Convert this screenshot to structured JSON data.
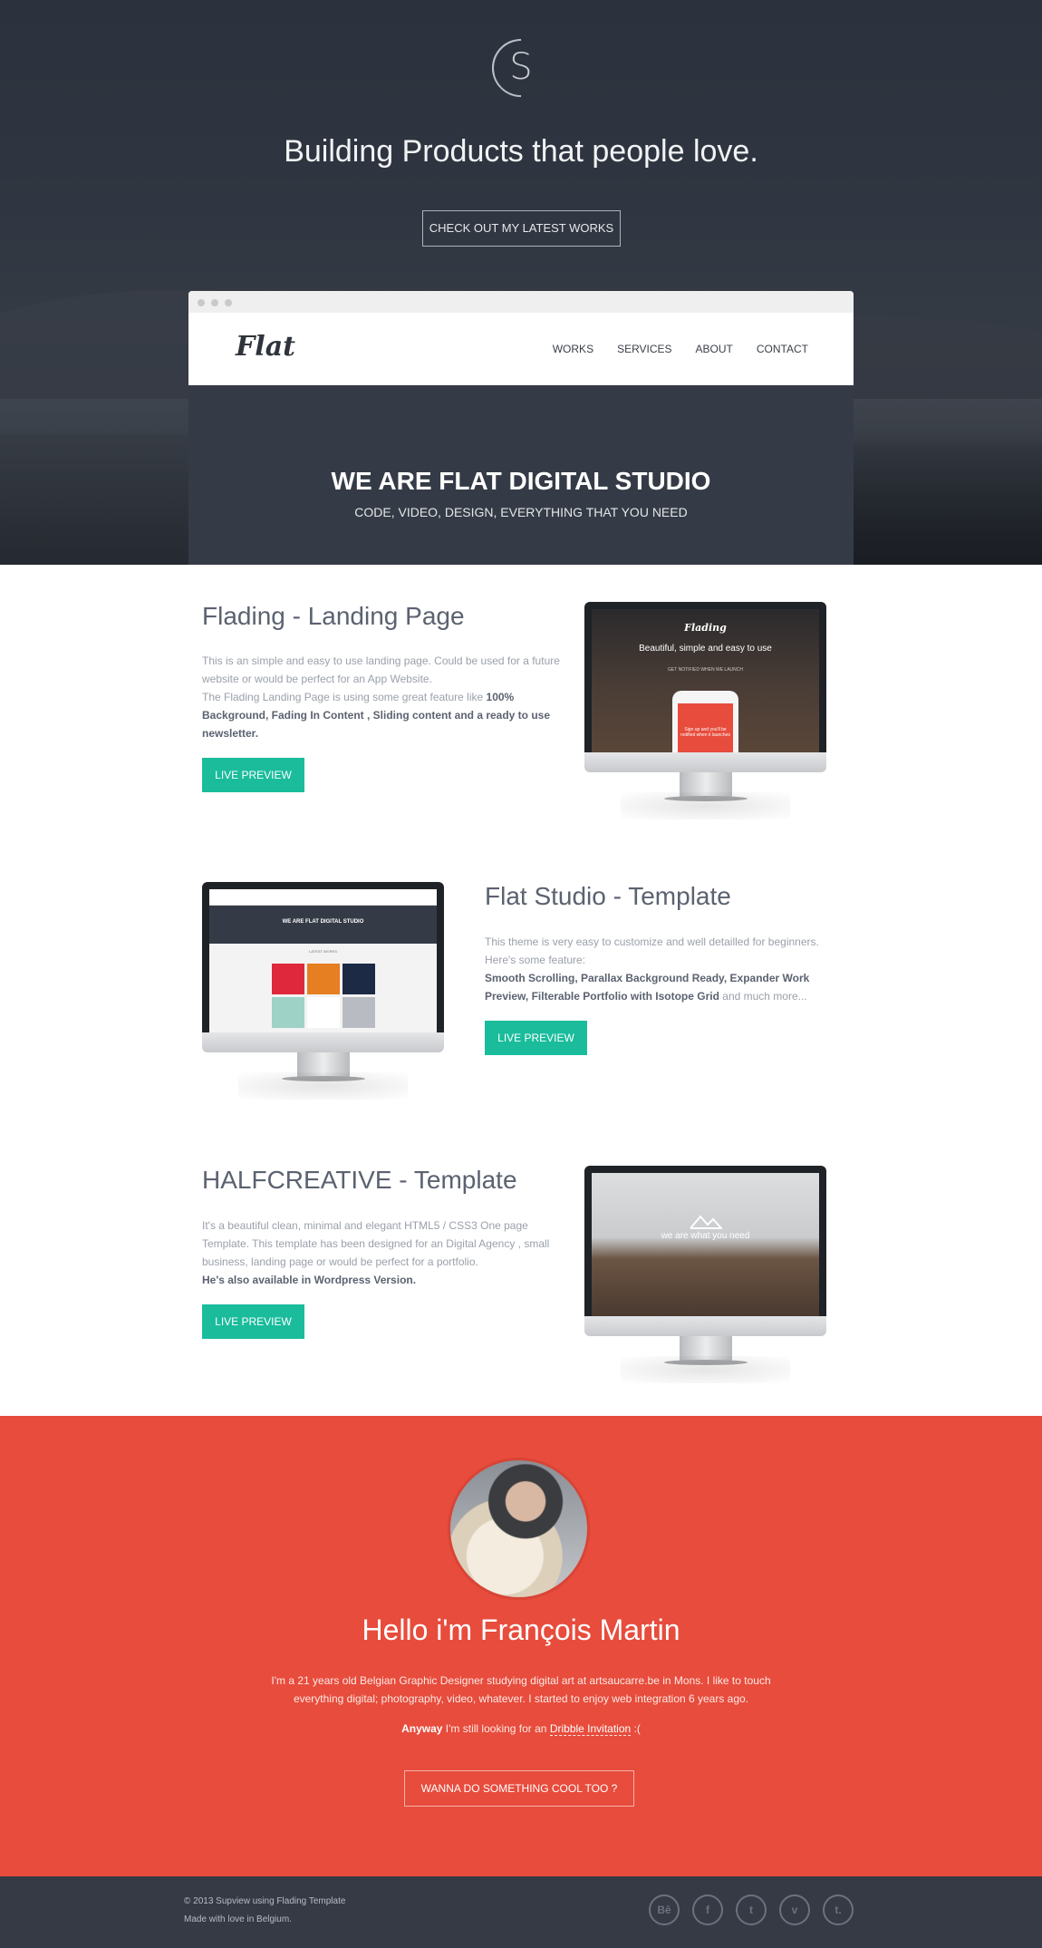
{
  "hero": {
    "logo_letter": "S",
    "title": "Building Products that people love.",
    "cta_label": "CHECK OUT MY LATEST WORKS"
  },
  "browser_mock": {
    "brand": "Flat",
    "nav": [
      "WORKS",
      "SERVICES",
      "ABOUT",
      "CONTACT"
    ],
    "banner_title": "WE ARE FLAT DIGITAL STUDIO",
    "banner_subtitle": "CODE, VIDEO, DESIGN, EVERYTHING THAT YOU NEED"
  },
  "works": [
    {
      "title": "Flading - Landing Page",
      "desc_1": "This is an simple and easy to use landing page. Could be used for a future website or would be perfect for an App Website.",
      "desc_2_pre": "The Flading Landing Page is using some great feature like ",
      "desc_2_bold": "100% Background, Fading In Content , Sliding content and a ready to use newsletter.",
      "button": "LIVE PREVIEW",
      "screen_logo": "Flading",
      "screen_headline": "Beautiful, simple and easy to use",
      "screen_small": "GET NOTIFIED WHEN WE LAUNCH",
      "screen_phone": "Sign up and you'll be notified when it launches"
    },
    {
      "title": "Flat Studio - Template",
      "desc_1": "This theme is very easy to customize and well detailled for beginners.",
      "desc_2": "Here's some feature:",
      "desc_3_bold": "Smooth Scrolling, Parallax Background Ready, Expander Work Preview, Filterable Portfolio with Isotope Grid",
      "desc_3_post": " and much more...",
      "button": "LIVE PREVIEW",
      "screen_headline": "WE ARE FLAT DIGITAL STUDIO",
      "screen_section": "LATEST WORKS"
    },
    {
      "title": "HALFCREATIVE - Template",
      "desc_1": "It's a beautiful clean, minimal and elegant HTML5 / CSS3 One page Template. This template has been designed for an Digital Agency , small business, landing page or would be perfect for a portfolio.",
      "desc_2_bold": "He's also available in Wordpress Version.",
      "button": "LIVE PREVIEW",
      "screen_headline": "we are what you need"
    }
  ],
  "about": {
    "title": "Hello i'm François Martin",
    "text": "I'm a 21 years old Belgian Graphic Designer studying digital art at artsaucarre.be in Mons. I like to touch everything digital; photography, video, whatever. I started to enjoy web integration 6 years ago.",
    "text2_bold": "Anyway",
    "text2_mid": " I'm still looking for an ",
    "text2_link": "Dribble Invitation",
    "text2_end": " :(",
    "button": "WANNA DO SOMETHING COOL TOO ?"
  },
  "footer": {
    "line1": "© 2013 Supview using Flading Template",
    "line2": "Made with love in Belgium.",
    "socials": [
      "Bē",
      "f",
      "t",
      "v",
      "t."
    ]
  },
  "colors": {
    "accent_green": "#1abc9c",
    "about_red": "#e74c3c",
    "dark": "#353a45"
  }
}
